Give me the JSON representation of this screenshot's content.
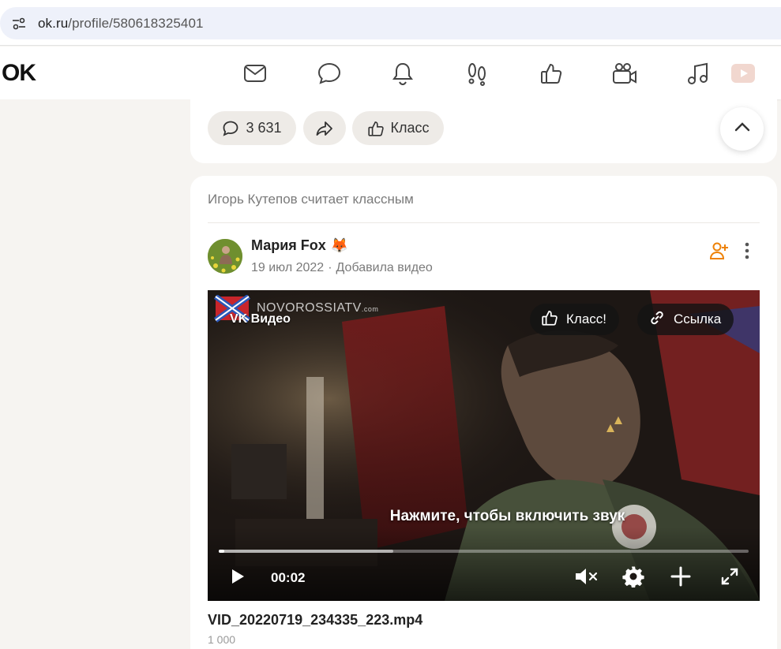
{
  "browser": {
    "url_host": "ok.ru",
    "url_path": "/profile/580618325401"
  },
  "header": {
    "logo": "OK",
    "nav_icons": [
      "mail-icon",
      "chat-icon",
      "bell-icon",
      "footprints-icon",
      "thumbs-up-icon",
      "video-camera-icon",
      "music-note-icon",
      "video-play-icon"
    ]
  },
  "prev_post_actions": {
    "comments_count": "3 631",
    "class_label": "Класс"
  },
  "feed_post": {
    "liked_by_text": "Игорь Кутепов считает классным",
    "author_name": "Мария Fox",
    "author_emoji": "🦊",
    "date": "19 июл 2022",
    "action": "Добавила видео",
    "video": {
      "provider_label": "VK Видео",
      "watermark": "NOVOROSSIATV",
      "watermark_suffix": ".com",
      "class_button": "Класс!",
      "link_button": "Ссылка",
      "unmute_hint": "Нажмите, чтобы включить звук",
      "current_time": "00:02",
      "progress_played_fraction": 0.01,
      "progress_buffered_fraction": 0.33
    },
    "video_title": "VID_20220719_234335_223.mp4",
    "views": "1 000"
  },
  "colors": {
    "accent_orange": "#ee8208",
    "page_bg": "#f6f4f1",
    "pill_bg": "#eeebe7"
  }
}
